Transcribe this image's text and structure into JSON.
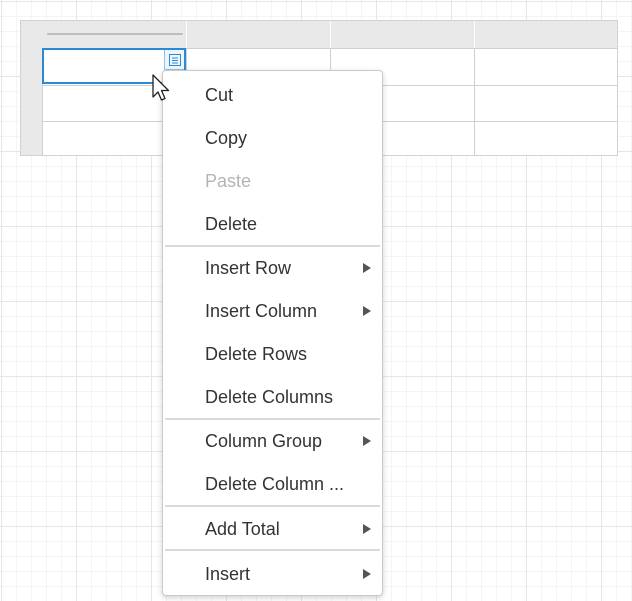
{
  "colors": {
    "accent": "#2b8ad6",
    "menu_text": "#333333",
    "disabled_text": "#b4b4b4"
  },
  "table": {
    "rows": 3,
    "columns": 4,
    "selected_cell": {
      "row": 1,
      "column": 1
    }
  },
  "context_menu": {
    "items": [
      {
        "label": "Cut",
        "enabled": true,
        "submenu": false
      },
      {
        "label": "Copy",
        "enabled": true,
        "submenu": false
      },
      {
        "label": "Paste",
        "enabled": false,
        "submenu": false
      },
      {
        "label": "Delete",
        "enabled": true,
        "submenu": false
      },
      {
        "label": "Insert Row",
        "enabled": true,
        "submenu": true
      },
      {
        "label": "Insert Column",
        "enabled": true,
        "submenu": true
      },
      {
        "label": "Delete Rows",
        "enabled": true,
        "submenu": false
      },
      {
        "label": "Delete Columns",
        "enabled": true,
        "submenu": false
      },
      {
        "label": "Column Group",
        "enabled": true,
        "submenu": true
      },
      {
        "label": "Delete Column ...",
        "enabled": true,
        "submenu": false
      },
      {
        "label": "Add Total",
        "enabled": true,
        "submenu": true
      },
      {
        "label": "Insert",
        "enabled": true,
        "submenu": true
      }
    ]
  },
  "icons": {
    "cell_menu": "cell-menu-icon",
    "submenu_arrow": "triangle-right-icon",
    "cursor": "mouse-pointer-icon"
  }
}
